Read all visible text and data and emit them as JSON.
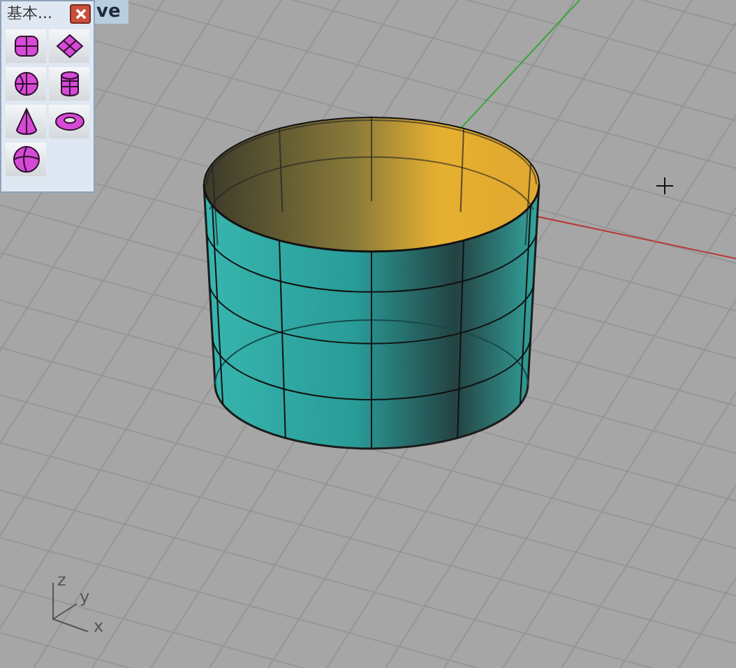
{
  "viewport": {
    "title_tab": "ve",
    "axis_labels": [
      "z",
      "y",
      "x"
    ]
  },
  "toolbar": {
    "title": "基本...",
    "buttons": [
      {
        "kind": "box"
      },
      {
        "kind": "plane"
      },
      {
        "kind": "sphere"
      },
      {
        "kind": "cylinder"
      },
      {
        "kind": "cone"
      },
      {
        "kind": "torus"
      },
      {
        "kind": "ellipsoid"
      }
    ]
  }
}
